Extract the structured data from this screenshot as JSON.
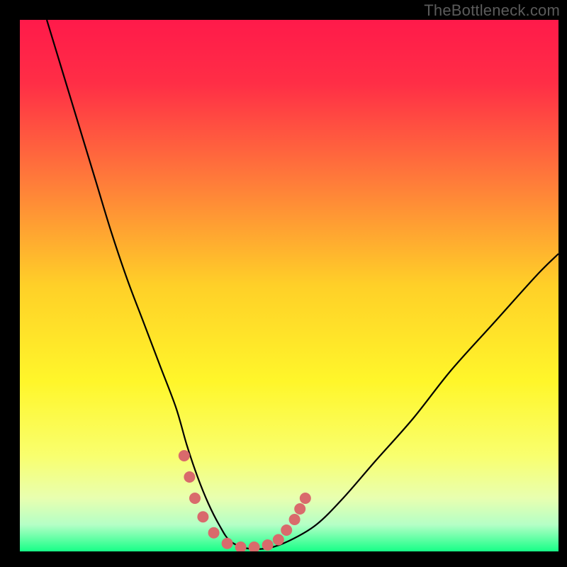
{
  "watermark": "TheBottleneck.com",
  "chart_data": {
    "type": "line",
    "title": "",
    "xlabel": "",
    "ylabel": "",
    "xlim": [
      0,
      100
    ],
    "ylim": [
      0,
      100
    ],
    "background_gradient": {
      "stops": [
        {
          "offset": 0.0,
          "color": "#ff1a4a"
        },
        {
          "offset": 0.12,
          "color": "#ff2e46"
        },
        {
          "offset": 0.3,
          "color": "#ff7a3a"
        },
        {
          "offset": 0.5,
          "color": "#ffd028"
        },
        {
          "offset": 0.68,
          "color": "#fff62a"
        },
        {
          "offset": 0.82,
          "color": "#f9ff6e"
        },
        {
          "offset": 0.9,
          "color": "#e8ffb0"
        },
        {
          "offset": 0.95,
          "color": "#b4ffc6"
        },
        {
          "offset": 1.0,
          "color": "#17ff87"
        }
      ]
    },
    "series": [
      {
        "name": "bottleneck-curve",
        "x": [
          5,
          8,
          11,
          14,
          17,
          20,
          23,
          26,
          29,
          31,
          33,
          35,
          37,
          39,
          42,
          46,
          50,
          55,
          60,
          66,
          73,
          80,
          88,
          96,
          100
        ],
        "y": [
          100,
          90,
          80,
          70,
          60,
          51,
          43,
          35,
          27,
          20,
          14,
          9,
          5,
          2,
          0.6,
          0.6,
          2,
          5,
          10,
          17,
          25,
          34,
          43,
          52,
          56
        ]
      }
    ],
    "trough_markers": {
      "name": "trough-dots",
      "points": [
        {
          "x": 30.5,
          "y": 18
        },
        {
          "x": 31.5,
          "y": 14
        },
        {
          "x": 32.5,
          "y": 10
        },
        {
          "x": 34.0,
          "y": 6.5
        },
        {
          "x": 36.0,
          "y": 3.5
        },
        {
          "x": 38.5,
          "y": 1.5
        },
        {
          "x": 41.0,
          "y": 0.8
        },
        {
          "x": 43.5,
          "y": 0.8
        },
        {
          "x": 46.0,
          "y": 1.2
        },
        {
          "x": 48.0,
          "y": 2.2
        },
        {
          "x": 49.5,
          "y": 4.0
        },
        {
          "x": 51.0,
          "y": 6.0
        },
        {
          "x": 52.0,
          "y": 8.0
        },
        {
          "x": 53.0,
          "y": 10.0
        }
      ],
      "color": "#d96a6c",
      "radius": 8
    }
  }
}
